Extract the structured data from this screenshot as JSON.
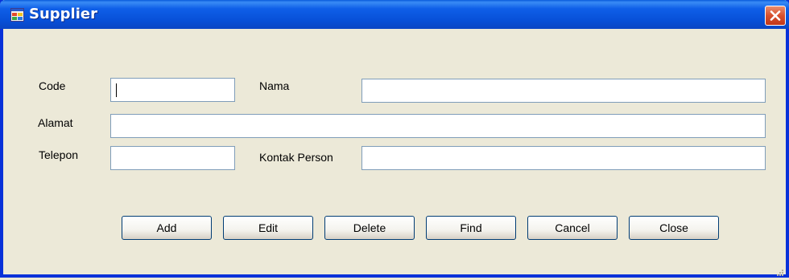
{
  "window": {
    "title": "Supplier"
  },
  "form": {
    "code": {
      "label": "Code",
      "value": ""
    },
    "nama": {
      "label": "Nama",
      "value": ""
    },
    "alamat": {
      "label": "Alamat",
      "value": ""
    },
    "telepon": {
      "label": "Telepon",
      "value": ""
    },
    "kontak_person": {
      "label": "Kontak Person",
      "value": ""
    }
  },
  "buttons": {
    "add": "Add",
    "edit": "Edit",
    "delete": "Delete",
    "find": "Find",
    "cancel": "Cancel",
    "close": "Close"
  },
  "icons": {
    "app": "form-window-icon",
    "close": "close-icon"
  },
  "colors": {
    "titlebar": "#0a5bdc",
    "window_bg": "#ece9d8",
    "close_button": "#d8502e",
    "field_border": "#7f9db9",
    "button_border": "#003c74"
  }
}
